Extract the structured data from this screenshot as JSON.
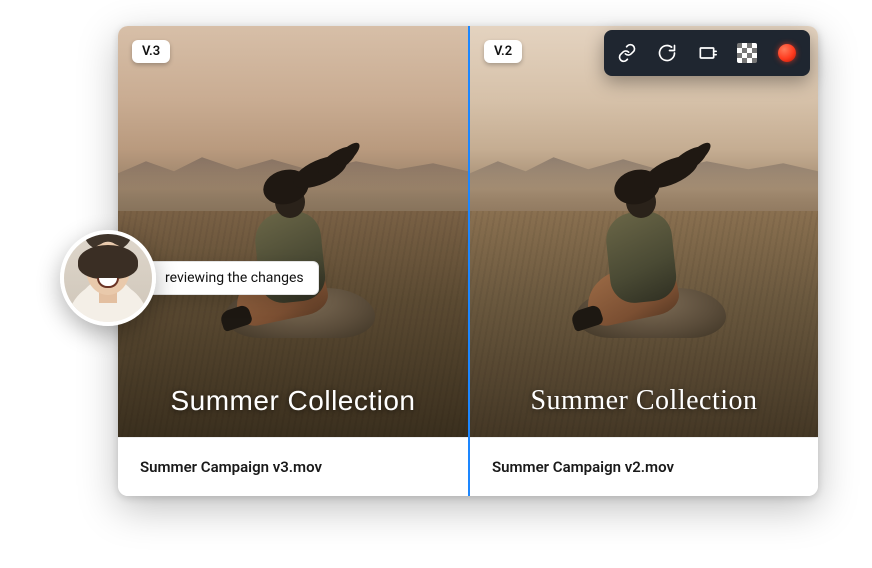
{
  "panes": {
    "left": {
      "version_badge": "V.3",
      "overlay_title": "Summer Collection",
      "filename": "Summer Campaign v3.mov"
    },
    "right": {
      "version_badge": "V.2",
      "overlay_title": "Summer Collection",
      "filename": "Summer Campaign v2.mov"
    }
  },
  "toolbar": {
    "icons": {
      "link": "link-icon",
      "refresh": "refresh-icon",
      "artboard": "artboard-icon",
      "checker": "transparency-icon",
      "record": "record-icon"
    }
  },
  "reviewer": {
    "status": "reviewing the changes"
  }
}
